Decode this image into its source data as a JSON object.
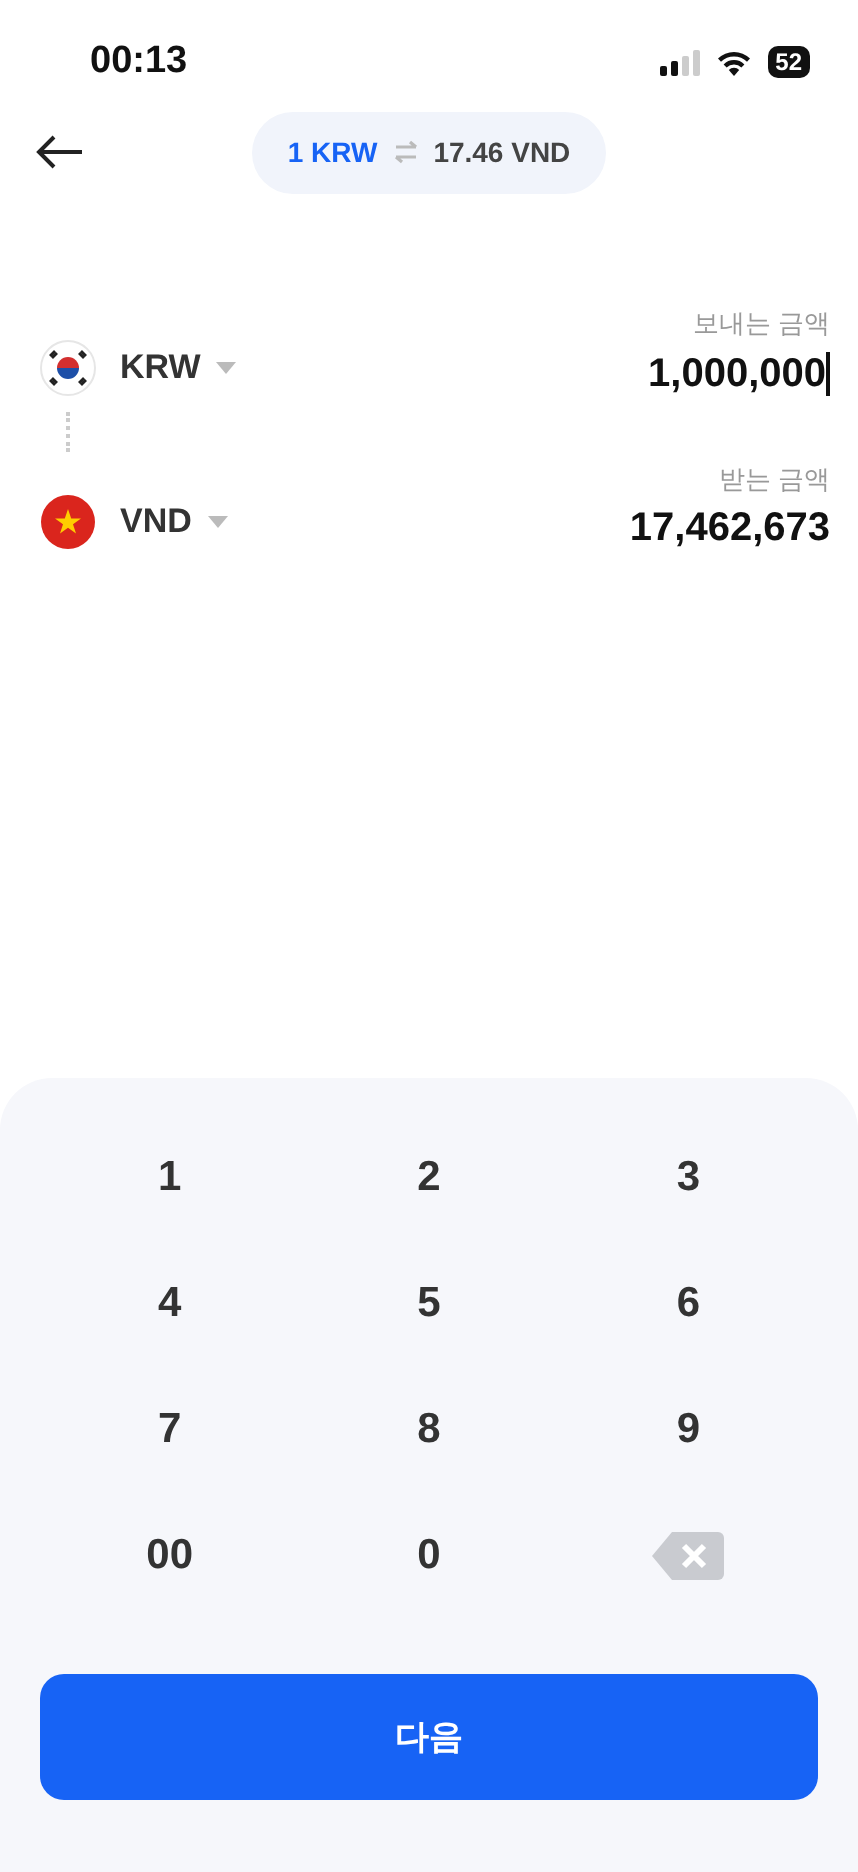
{
  "status_bar": {
    "time": "00:13",
    "battery": "52"
  },
  "header": {
    "rate_from": "1 KRW",
    "rate_to": "17.46 VND"
  },
  "currencies": [
    {
      "kind": "korea",
      "code": "KRW",
      "label": "보내는 금액",
      "amount": "1,000,000",
      "focused": true
    },
    {
      "kind": "vietnam",
      "code": "VND",
      "label": "받는 금액",
      "amount": "17,462,673",
      "focused": false
    }
  ],
  "keypad": [
    {
      "kind": "digit",
      "label": "1"
    },
    {
      "kind": "digit",
      "label": "2"
    },
    {
      "kind": "digit",
      "label": "3"
    },
    {
      "kind": "digit",
      "label": "4"
    },
    {
      "kind": "digit",
      "label": "5"
    },
    {
      "kind": "digit",
      "label": "6"
    },
    {
      "kind": "digit",
      "label": "7"
    },
    {
      "kind": "digit",
      "label": "8"
    },
    {
      "kind": "digit",
      "label": "9"
    },
    {
      "kind": "digit",
      "label": "00"
    },
    {
      "kind": "digit",
      "label": "0"
    },
    {
      "kind": "backspace"
    }
  ],
  "next_button": "다음"
}
